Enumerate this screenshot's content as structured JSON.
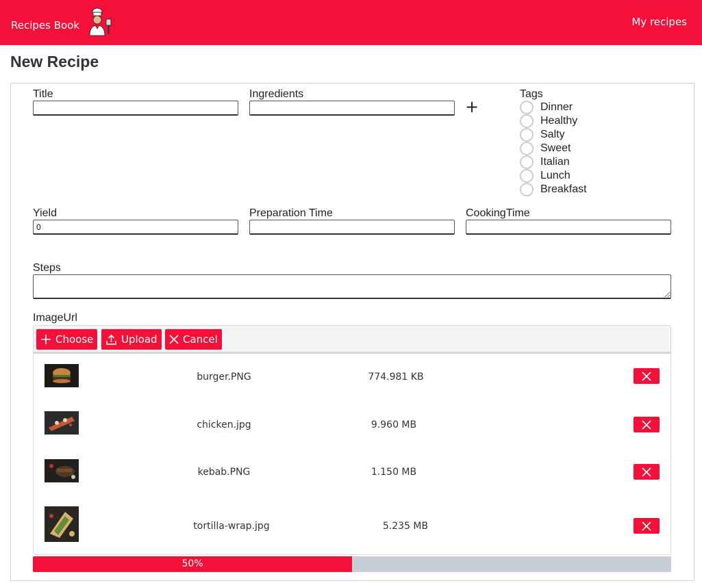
{
  "header": {
    "brand": "Recipes Book",
    "nav_my_recipes": "My recipes",
    "logo_icon": "chef-icon",
    "accent": "#f5103a"
  },
  "page": {
    "title": "New Recipe"
  },
  "form": {
    "title_label": "Title",
    "title_value": "",
    "ingredients_label": "Ingredients",
    "ingredients_value": "",
    "add_ingredient_icon": "plus-icon",
    "tags_label": "Tags",
    "tags": [
      "Dinner",
      "Healthy",
      "Salty",
      "Sweet",
      "Italian",
      "Lunch",
      "Breakfast"
    ],
    "yield_label": "Yield",
    "yield_value": "0",
    "prep_label": "Preparation Time",
    "prep_value": "",
    "cooking_label": "CookingTime",
    "cooking_value": "",
    "steps_label": "Steps",
    "steps_value": "",
    "image_label": "ImageUrl"
  },
  "uploader": {
    "choose_label": "Choose",
    "upload_label": "Upload",
    "cancel_label": "Cancel",
    "files": [
      {
        "name": "burger.PNG",
        "size": "774.981 KB"
      },
      {
        "name": "chicken.jpg",
        "size": "9.960 MB"
      },
      {
        "name": "kebab.PNG",
        "size": "1.150 MB"
      },
      {
        "name": "tortilla-wrap.jpg",
        "size": "5.235 MB"
      }
    ],
    "progress_label": "50%",
    "progress_value": 0.5
  }
}
